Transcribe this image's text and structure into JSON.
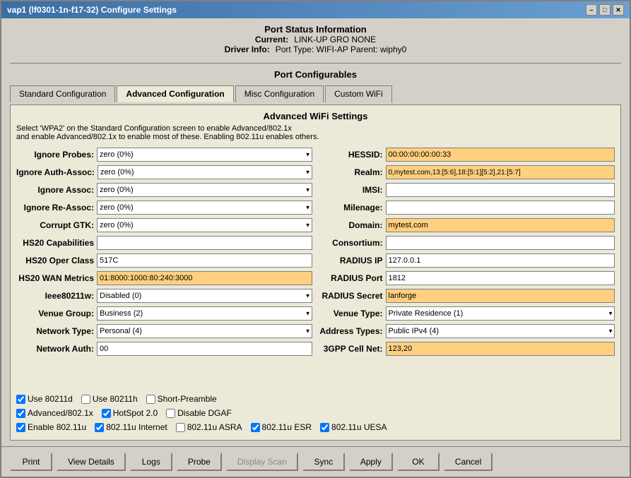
{
  "window": {
    "title": "vap1  (lf0301-1n-f17-32) Configure Settings"
  },
  "title_bar_buttons": {
    "minimize": "–",
    "maximize": "□",
    "close": "✕"
  },
  "port_status": {
    "section_title": "Port Status Information",
    "current_label": "Current:",
    "current_value": "LINK-UP GRO  NONE",
    "driver_label": "Driver Info:",
    "driver_value": "Port Type: WIFI-AP   Parent: wiphy0"
  },
  "port_configurables": {
    "title": "Port Configurables"
  },
  "tabs": [
    {
      "label": "Standard Configuration",
      "id": "standard"
    },
    {
      "label": "Advanced Configuration",
      "id": "advanced",
      "active": true
    },
    {
      "label": "Misc Configuration",
      "id": "misc"
    },
    {
      "label": "Custom WiFi",
      "id": "custom"
    }
  ],
  "advanced": {
    "section_title": "Advanced WiFi Settings",
    "description": "Select 'WPA2' on the Standard Configuration screen to enable Advanced/802.1x\nand enable Advanced/802.1x to enable most of these. Enabling 802.11u enables others.",
    "left_fields": [
      {
        "label": "Ignore Probes:",
        "type": "select",
        "value": "zero (0%)",
        "options": [
          "zero (0%)"
        ]
      },
      {
        "label": "Ignore Auth-Assoc:",
        "type": "select",
        "value": "zero (0%)",
        "options": [
          "zero (0%)"
        ]
      },
      {
        "label": "Ignore Assoc:",
        "type": "select",
        "value": "zero (0%)",
        "options": [
          "zero (0%)"
        ]
      },
      {
        "label": "Ignore Re-Assoc:",
        "type": "select",
        "value": "zero (0%)",
        "options": [
          "zero (0%)"
        ]
      },
      {
        "label": "Corrupt GTK:",
        "type": "select",
        "value": "zero (0%)",
        "options": [
          "zero (0%)"
        ]
      },
      {
        "label": "HS20 Capabilities",
        "type": "input",
        "value": ""
      },
      {
        "label": "HS20 Oper Class",
        "type": "input",
        "value": "517C"
      },
      {
        "label": "HS20 WAN Metrics",
        "type": "input",
        "value": "01:8000:1000:80:240:3000",
        "highlighted": true
      },
      {
        "label": "Ieee80211w:",
        "type": "select",
        "value": "Disabled (0)",
        "options": [
          "Disabled (0)"
        ]
      },
      {
        "label": "Venue Group:",
        "type": "select",
        "value": "Business (2)",
        "options": [
          "Business (2)"
        ]
      },
      {
        "label": "Network Type:",
        "type": "select",
        "value": "Personal (4)",
        "options": [
          "Personal (4)"
        ]
      },
      {
        "label": "Network Auth:",
        "type": "input",
        "value": "00"
      }
    ],
    "right_fields": [
      {
        "label": "HESSID:",
        "type": "input",
        "value": "00:00:00:00:00:33",
        "highlighted": true
      },
      {
        "label": "Realm:",
        "type": "input",
        "value": "0,mytest.com,13:[5:6],18:[5:1][5:2],21:[5:7]",
        "highlighted": true
      },
      {
        "label": "IMSI:",
        "type": "input",
        "value": ""
      },
      {
        "label": "Milenage:",
        "type": "input",
        "value": ""
      },
      {
        "label": "Domain:",
        "type": "input",
        "value": "mytest.com",
        "highlighted": true
      },
      {
        "label": "Consortium:",
        "type": "input",
        "value": ""
      },
      {
        "label": "RADIUS IP",
        "type": "input",
        "value": "127.0.0.1"
      },
      {
        "label": "RADIUS Port",
        "type": "input",
        "value": "1812"
      },
      {
        "label": "RADIUS Secret",
        "type": "input",
        "value": "lanforge",
        "highlighted": true
      },
      {
        "label": "Venue Type:",
        "type": "select-wide",
        "value": "Private Residence (1)",
        "options": [
          "Private Residence (1)"
        ]
      },
      {
        "label": "Address Types:",
        "type": "select-wide",
        "value": "Public IPv4 (4)",
        "options": [
          "Public IPv4 (4)"
        ]
      },
      {
        "label": "3GPP Cell Net:",
        "type": "input",
        "value": "123,20",
        "highlighted": true
      }
    ],
    "checkboxes_row1": [
      {
        "label": "Use 80211d",
        "checked": true
      },
      {
        "label": "Use 80211h",
        "checked": false
      },
      {
        "label": "Short-Preamble",
        "checked": false
      }
    ],
    "checkboxes_row2": [
      {
        "label": "Advanced/802.1x",
        "checked": true
      },
      {
        "label": "HotSpot 2.0",
        "checked": true
      },
      {
        "label": "Disable DGAF",
        "checked": false
      }
    ],
    "checkboxes_row3": [
      {
        "label": "Enable 802.11u",
        "checked": true
      },
      {
        "label": "802.11u Internet",
        "checked": true
      },
      {
        "label": "802.11u ASRA",
        "checked": false
      },
      {
        "label": "802.11u ESR",
        "checked": true
      },
      {
        "label": "802.11u UESA",
        "checked": true
      }
    ]
  },
  "buttons": {
    "print": "Print",
    "view_details": "View Details",
    "logs": "Logs",
    "probe": "Probe",
    "display_scan": "Display Scan",
    "sync": "Sync",
    "apply": "Apply",
    "ok": "OK",
    "cancel": "Cancel"
  }
}
